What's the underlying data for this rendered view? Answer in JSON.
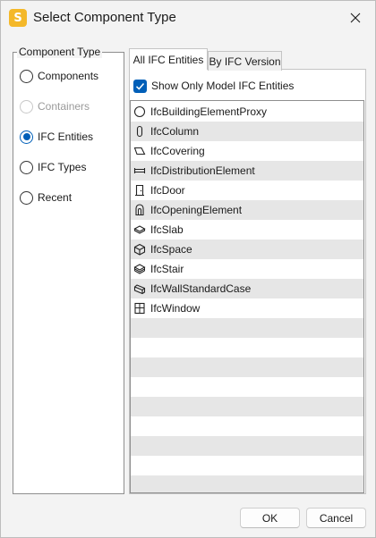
{
  "window": {
    "title": "Select Component Type",
    "app_icon_letter": "S",
    "accent_color": "#005fb8",
    "app_icon_color": "#f4b829"
  },
  "component_type": {
    "legend": "Component Type",
    "options": [
      {
        "label": "Components",
        "state": "unchecked"
      },
      {
        "label": "Containers",
        "state": "disabled"
      },
      {
        "label": "IFC Entities",
        "state": "checked"
      },
      {
        "label": "IFC Types",
        "state": "unchecked"
      },
      {
        "label": "Recent",
        "state": "unchecked"
      }
    ]
  },
  "tabs": [
    {
      "label": "All IFC Entities",
      "active": true
    },
    {
      "label": "By IFC Version",
      "active": false
    }
  ],
  "filter": {
    "label": "Show Only Model IFC Entities",
    "checked": true
  },
  "entities": [
    {
      "label": "IfcBuildingElementProxy",
      "icon": "circle-icon"
    },
    {
      "label": "IfcColumn",
      "icon": "column-icon"
    },
    {
      "label": "IfcCovering",
      "icon": "covering-icon"
    },
    {
      "label": "IfcDistributionElement",
      "icon": "distribution-icon"
    },
    {
      "label": "IfcDoor",
      "icon": "door-icon"
    },
    {
      "label": "IfcOpeningElement",
      "icon": "opening-icon"
    },
    {
      "label": "IfcSlab",
      "icon": "slab-icon"
    },
    {
      "label": "IfcSpace",
      "icon": "space-cube-icon"
    },
    {
      "label": "IfcStair",
      "icon": "stair-icon"
    },
    {
      "label": "IfcWallStandardCase",
      "icon": "wall-icon"
    },
    {
      "label": "IfcWindow",
      "icon": "window-icon"
    }
  ],
  "buttons": {
    "ok": "OK",
    "cancel": "Cancel"
  }
}
